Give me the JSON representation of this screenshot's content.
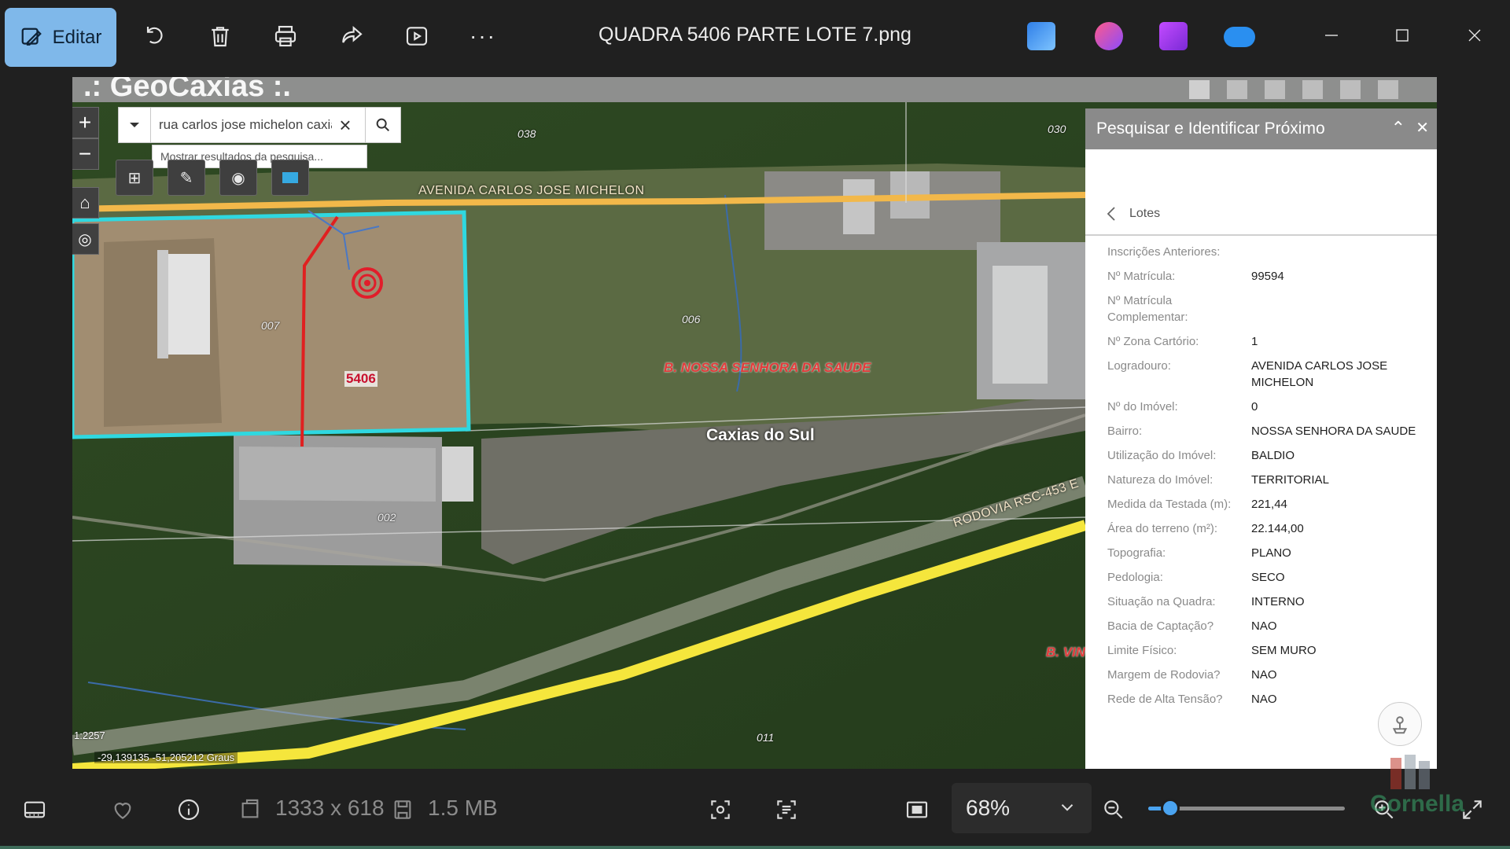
{
  "toolbar": {
    "edit_label": "Editar",
    "file_name": "QUADRA 5406 PARTE LOTE 7.png",
    "icons": [
      "edit-image-icon",
      "rotate-icon",
      "delete-icon",
      "print-icon",
      "share-icon",
      "slideshow-icon",
      "more-icon"
    ],
    "more_label": "···"
  },
  "map": {
    "app_title": ".: GeoCaxias :.",
    "search": {
      "value": "rua carlos jose michelon caxias",
      "hint": "Mostrar resultados da pesquisa..."
    },
    "street_avenida": "AVENIDA CARLOS JOSE MICHELON",
    "street_rodovia": "RODOVIA RSC-453 E",
    "bairro": "B. NOSSA SENHORA DA SAUDE",
    "bairro_partial": "B. VIN",
    "city": "Caxias do Sul",
    "lot_number": "5406",
    "parcel_labels": [
      "038",
      "030",
      "007",
      "006",
      "002",
      "011"
    ],
    "scale_text": "1:2257",
    "coords": "-29,139135 -51,205212 Graus",
    "colors": {
      "lot_outline": "#2fd8e0",
      "red_line": "#e02020",
      "road_yellow": "#f5e63c",
      "road_orange": "#f2b84a"
    }
  },
  "panel": {
    "title": "Pesquisar e Identificar Próximo",
    "back_label": "Lotes",
    "attributes": [
      {
        "k": "Inscrições Anteriores:",
        "v": ""
      },
      {
        "k": "Nº Matrícula:",
        "v": "99594"
      },
      {
        "k": "Nº Matrícula Complementar:",
        "v": ""
      },
      {
        "k": "Nº Zona Cartório:",
        "v": "1"
      },
      {
        "k": "Logradouro:",
        "v": "AVENIDA CARLOS JOSE MICHELON"
      },
      {
        "k": "Nº do Imóvel:",
        "v": "0"
      },
      {
        "k": "Bairro:",
        "v": "NOSSA SENHORA DA SAUDE"
      },
      {
        "k": "Utilização do Imóvel:",
        "v": "BALDIO"
      },
      {
        "k": "Natureza do Imóvel:",
        "v": "TERRITORIAL"
      },
      {
        "k": "Medida da Testada (m):",
        "v": "221,44"
      },
      {
        "k": "Área do terreno (m²):",
        "v": "22.144,00"
      },
      {
        "k": "Topografia:",
        "v": "PLANO"
      },
      {
        "k": "Pedologia:",
        "v": "SECO"
      },
      {
        "k": "Situação na Quadra:",
        "v": "INTERNO"
      },
      {
        "k": "Bacia de Captação?",
        "v": "NAO"
      },
      {
        "k": "Limite Físico:",
        "v": "SEM MURO"
      },
      {
        "k": "Margem de Rodovia?",
        "v": "NAO"
      },
      {
        "k": "Rede de Alta Tensão?",
        "v": "NAO"
      }
    ]
  },
  "status": {
    "dimensions": "1333 x 618",
    "file_size": "1.5 MB",
    "zoom": "68%",
    "zoom_fraction": 0.11
  },
  "watermark": "Cornella"
}
